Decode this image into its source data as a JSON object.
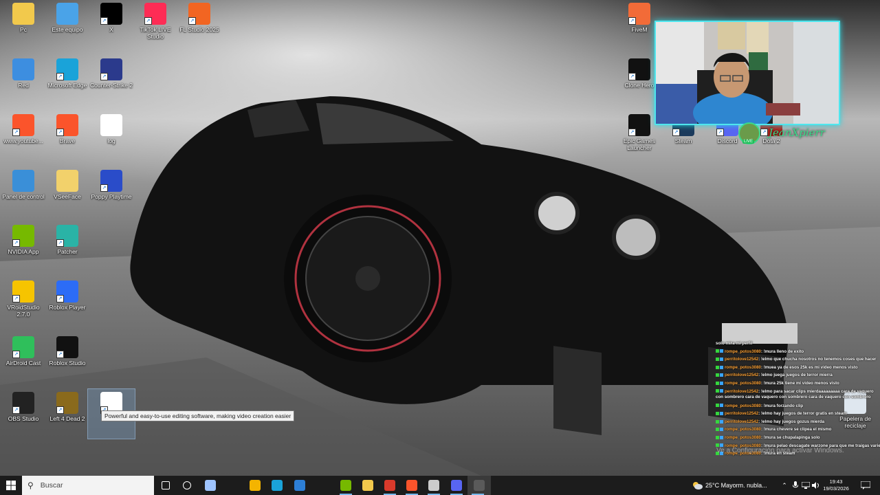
{
  "desktop": {
    "icons": [
      {
        "label": "Pc",
        "icon": "folder-user-icon",
        "color": "#f2c94c"
      },
      {
        "label": "Este equipo",
        "icon": "computer-icon",
        "color": "#4aa3e8"
      },
      {
        "label": "X",
        "icon": "x-logo-icon",
        "color": "#000000"
      },
      {
        "label": "TikTok LIVE Studio",
        "icon": "tiktok-live-icon",
        "color": "#fe2c55"
      },
      {
        "label": "FL Studio 2025",
        "icon": "fl-studio-icon",
        "color": "#f26522"
      },
      {
        "label": "Red",
        "icon": "network-globe-icon",
        "color": "#3d8ee0"
      },
      {
        "label": "Microsoft Edge",
        "icon": "edge-icon",
        "color": "#1aa3d9"
      },
      {
        "label": "Counter-Strike 2",
        "icon": "counter-strike-icon",
        "color": "#2b3a8c"
      },
      {
        "label": "www.youtube...",
        "icon": "brave-icon",
        "color": "#fb542b"
      },
      {
        "label": "Brave",
        "icon": "brave-icon",
        "color": "#fb542b"
      },
      {
        "label": "log",
        "icon": "text-file-icon",
        "color": "#ffffff"
      },
      {
        "label": "Panel de control",
        "icon": "control-panel-icon",
        "color": "#3a8fd8"
      },
      {
        "label": "VSeeFace",
        "icon": "folder-icon",
        "color": "#f2d16b"
      },
      {
        "label": "Poppy Playtime",
        "icon": "poppy-playtime-icon",
        "color": "#2a4cc9"
      },
      {
        "label": "NVIDIA App",
        "icon": "nvidia-icon",
        "color": "#76b900"
      },
      {
        "label": "Patcher",
        "icon": "patcher-icon",
        "color": "#2ab3a6"
      },
      {
        "label": "VRoidStudio 2.7.0",
        "icon": "vroid-studio-icon",
        "color": "#f6c400"
      },
      {
        "label": "Roblox Player",
        "icon": "roblox-player-icon",
        "color": "#2c6cf6"
      },
      {
        "label": "AirDroid Cast",
        "icon": "airdroid-cast-icon",
        "color": "#2fbf5b"
      },
      {
        "label": "Roblox Studio",
        "icon": "roblox-studio-icon",
        "color": "#111111"
      },
      {
        "label": "OBS Studio",
        "icon": "obs-studio-icon",
        "color": "#222222"
      },
      {
        "label": "Left 4 Dead 2",
        "icon": "left4dead2-icon",
        "color": "#8a6a1c"
      },
      {
        "label": "",
        "icon": "capcut-icon",
        "color": "#ffffff"
      },
      {
        "label": "FiveM",
        "icon": "fivem-icon",
        "color": "#f26b38"
      },
      {
        "label": "Clone Hero",
        "icon": "clone-hero-icon",
        "color": "#111111"
      },
      {
        "label": "Epic Games Launcher",
        "icon": "epic-games-icon",
        "color": "#111111"
      },
      {
        "label": "Steam",
        "icon": "steam-icon",
        "color": "#1b3a5c"
      },
      {
        "label": "Discord",
        "icon": "discord-icon",
        "color": "#5865f2"
      },
      {
        "label": "Dota 2",
        "icon": "dota2-icon",
        "color": "#b3261e"
      },
      {
        "label": "Papelera de reciclaje",
        "icon": "recycle-bin-icon",
        "color": "#dfe7ef"
      }
    ],
    "tooltip": "Powerful and easy-to-use editing software, making video creation easier",
    "activate_windows": "Ve a Configuración para activar Windows."
  },
  "stream_overlay": {
    "streamer_name": "JeanXpierr",
    "live_badge": "LIVE"
  },
  "chat": [
    {
      "user": "",
      "text": "solo mira mi perfil"
    },
    {
      "user": "rompe_potos3080",
      "text": ": !mura lleno de exito"
    },
    {
      "user": "perritolove12542",
      "text": ": !elmo que chucha nosotros no tenemos coses que hacer"
    },
    {
      "user": "rompe_potos3080",
      "text": ": !muea ya de esos 25k es mi video menos visto"
    },
    {
      "user": "perritolove12542",
      "text": ": !elmo juega juegos de terror mierra"
    },
    {
      "user": "rompe_potos3080",
      "text": ": !mura 25k tiene mi video menos visto"
    },
    {
      "user": "perritolove12542",
      "text": ": !elmo para sacar clips mierdaaaaaaaaa cara de vaquero con sombrero cara de vaquero con sombrero cara de vaquero con sombrero"
    },
    {
      "user": "rompe_potos3080",
      "text": ": !mura forzando clip"
    },
    {
      "user": "perritolove12542",
      "text": ": !elmo hay juegos de terror gratis en steam"
    },
    {
      "user": "perritolove12542",
      "text": ": !elmo hay juegos gozus mierda"
    },
    {
      "user": "rompe_potos3080",
      "text": ": !mura chevere se clipea el mismo"
    },
    {
      "user": "rompe_potos3080",
      "text": ": !mura se chupalapinga solo"
    },
    {
      "user": "rompe_potos3080",
      "text": ": !mura pelao descagate warzone para que me traigas variedad"
    },
    {
      "user": "rompe_potos3080",
      "text": ": !mura en steam"
    }
  ],
  "taskbar": {
    "search_placeholder": "Buscar",
    "apps": [
      {
        "icon": "task-view-icon",
        "color": "#ffffff"
      },
      {
        "icon": "cortana-icon",
        "color": "#ffffff"
      },
      {
        "icon": "snipping-tool-icon",
        "color": "#9ec4ff"
      },
      {
        "icon": "microsoft-store-icon",
        "color": "#f4b400"
      },
      {
        "icon": "edge-icon",
        "color": "#1aa3d9"
      },
      {
        "icon": "mail-icon",
        "color": "#2d7fd6"
      },
      {
        "icon": "nvidia-icon",
        "color": "#76b900"
      },
      {
        "icon": "file-explorer-icon",
        "color": "#f2c94c"
      },
      {
        "icon": "adobe-red-icon",
        "color": "#d93a2b"
      },
      {
        "icon": "brave-icon",
        "color": "#fb542b"
      },
      {
        "icon": "obs-studio-icon",
        "color": "#cccccc"
      },
      {
        "icon": "discord-icon",
        "color": "#5865f2"
      },
      {
        "icon": "window-thumbnail-icon",
        "color": "#5a5a5a"
      }
    ],
    "weather": "25°C  Mayorm. nubla...",
    "time": "19:43",
    "date": "19/03/2026"
  }
}
